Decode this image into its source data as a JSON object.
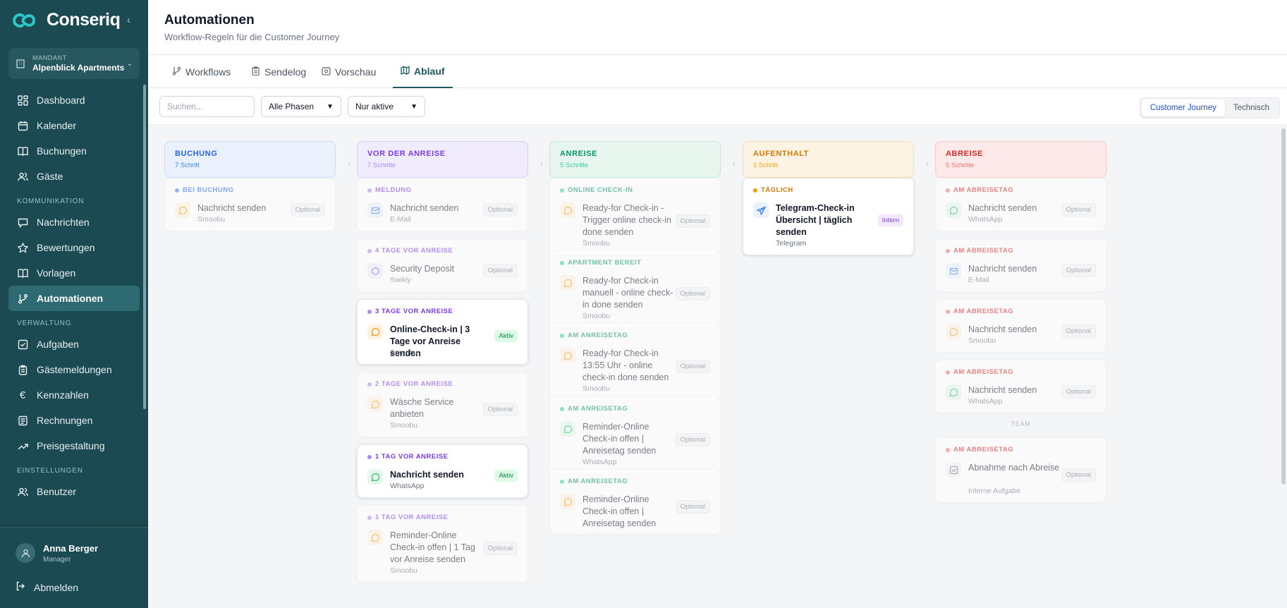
{
  "app": {
    "name": "Conseriq"
  },
  "tenant": {
    "label": "MANDANT",
    "name": "Alpenblick Apartments"
  },
  "nav": {
    "main": [
      {
        "label": "Dashboard",
        "icon": "dashboard-icon"
      },
      {
        "label": "Kalender",
        "icon": "calendar-icon"
      },
      {
        "label": "Buchungen",
        "icon": "book-icon"
      },
      {
        "label": "Gäste",
        "icon": "users-icon"
      }
    ],
    "sec1": "KOMMUNIKATION",
    "comm": [
      {
        "label": "Nachrichten",
        "icon": "message-icon"
      },
      {
        "label": "Bewertungen",
        "icon": "star-icon"
      },
      {
        "label": "Vorlagen",
        "icon": "template-icon"
      },
      {
        "label": "Automationen",
        "icon": "workflow-icon"
      }
    ],
    "sec2": "VERWALTUNG",
    "admin": [
      {
        "label": "Aufgaben",
        "icon": "checkbox-icon"
      },
      {
        "label": "Gästemeldungen",
        "icon": "clipboard-icon"
      },
      {
        "label": "Kennzahlen",
        "icon": "euro-icon"
      },
      {
        "label": "Rechnungen",
        "icon": "receipt-icon"
      },
      {
        "label": "Preisgestaltung",
        "icon": "trend-icon"
      }
    ],
    "sec3": "EINSTELLUNGEN",
    "settings": [
      {
        "label": "Benutzer",
        "icon": "users-icon"
      }
    ]
  },
  "user": {
    "name": "Anna Berger",
    "role": "Manager",
    "logout": "Abmelden"
  },
  "header": {
    "title": "Automationen",
    "subtitle": "Workflow-Regeln für die Customer Journey"
  },
  "tabs": [
    "Workflows",
    "Sendelog",
    "Vorschau",
    "Ablauf"
  ],
  "toolbar": {
    "search_placeholder": "Suchen...",
    "phase_select": "Alle Phasen",
    "status_select": "Nur aktive",
    "view_journey": "Customer Journey",
    "view_technical": "Technisch"
  },
  "colors": {
    "buchung": "#3b82f6",
    "vor": "#8b5cf6",
    "anreise": "#10b981",
    "aufenthalt": "#f59e0b",
    "abreise": "#ef4444",
    "sidebar": "#1c4a52"
  },
  "columns": [
    {
      "title": "BUCHUNG",
      "count": "7 Schritt",
      "cards": [
        {
          "trigger": "BEI BUCHUNG",
          "title": "Nachricht senden",
          "channel": "Smoobu",
          "badge": "Optional",
          "icon": "chat-icon"
        }
      ]
    },
    {
      "title": "VOR DER ANREISE",
      "count": "7 Schritte",
      "cards": [
        {
          "trigger": "MELDUNG",
          "title": "Nachricht senden",
          "channel": "E-Mail",
          "badge": "Optional",
          "icon": "mail-icon"
        },
        {
          "trigger": "4 TAGE VOR ANREISE",
          "title": "Security Deposit",
          "channel": "Swikly",
          "badge": "Optional",
          "icon": "shield-icon"
        },
        {
          "trigger": "3 TAGE VOR ANREISE",
          "title": "Online-Check-in | 3 Tage vor Anreise senden",
          "channel": "Smoobu",
          "badge": "Aktiv",
          "icon": "chat-icon"
        },
        {
          "trigger": "2 TAGE VOR ANREISE",
          "title": "Wäsche Service anbieten",
          "channel": "Smoobu",
          "badge": "Optional",
          "icon": "chat-icon"
        },
        {
          "trigger": "1 TAG VOR ANREISE",
          "title": "Nachricht senden",
          "channel": "WhatsApp",
          "badge": "Aktiv",
          "icon": "whatsapp-icon"
        },
        {
          "trigger": "1 TAG VOR ANREISE",
          "title": "Reminder-Online Check-in offen | 1 Tag vor Anreise senden",
          "channel": "Smoobu",
          "badge": "Optional",
          "icon": "chat-icon"
        }
      ]
    },
    {
      "title": "ANREISE",
      "count": "5 Schritte",
      "cards": [
        {
          "trigger": "ONLINE CHECK-IN",
          "title": "Ready-for Check-in - Trigger online check-in done senden",
          "channel": "Smoobu",
          "badge": "Optional",
          "icon": "chat-icon"
        },
        {
          "trigger": "APARTMENT BEREIT",
          "title": "Ready-for Check-in manuell - online check-in done senden",
          "channel": "Smoobu",
          "badge": "Optional",
          "icon": "chat-icon"
        },
        {
          "trigger": "AM ANREISETAG",
          "title": "Ready-for Check-in 13:55 Uhr - online check-in done senden",
          "channel": "Smoobu",
          "badge": "Optional",
          "icon": "chat-icon"
        },
        {
          "trigger": "AM ANREISETAG",
          "title": "Reminder-Online Check-in offen | Anreisetag senden",
          "channel": "WhatsApp",
          "badge": "Optional",
          "icon": "whatsapp-icon"
        },
        {
          "trigger": "AM ANREISETAG",
          "title": "Reminder-Online Check-in offen | Anreisetag senden",
          "channel": "",
          "badge": "Optional",
          "icon": "chat-icon"
        }
      ]
    },
    {
      "title": "AUFENTHALT",
      "count": "1 Schritt",
      "cards": [
        {
          "trigger": "TÄGLICH",
          "title": "Telegram-Check-in Übersicht | täglich senden",
          "channel": "Telegram",
          "badge": "Intern",
          "icon": "telegram-icon"
        }
      ]
    },
    {
      "title": "ABREISE",
      "count": "5 Schritte",
      "cards": [
        {
          "trigger": "AM ABREISETAG",
          "title": "Nachricht senden",
          "channel": "WhatsApp",
          "badge": "Optional",
          "icon": "whatsapp-icon"
        },
        {
          "trigger": "AM ABREISETAG",
          "title": "Nachricht senden",
          "channel": "E-Mail",
          "badge": "Optional",
          "icon": "mail-icon"
        },
        {
          "trigger": "AM ABREISETAG",
          "title": "Nachricht senden",
          "channel": "Smoobu",
          "badge": "Optional",
          "icon": "chat-icon"
        },
        {
          "trigger": "AM ABREISETAG",
          "title": "Nachricht senden",
          "channel": "WhatsApp",
          "badge": "Optional",
          "icon": "whatsapp-icon"
        },
        {
          "trigger": "AM ABREISETAG",
          "title": "Abnahme nach Abreise",
          "channel": "Interne Aufgabe",
          "badge": "Optional",
          "icon": "checkbox-icon"
        }
      ],
      "team_label": "TEAM"
    }
  ]
}
